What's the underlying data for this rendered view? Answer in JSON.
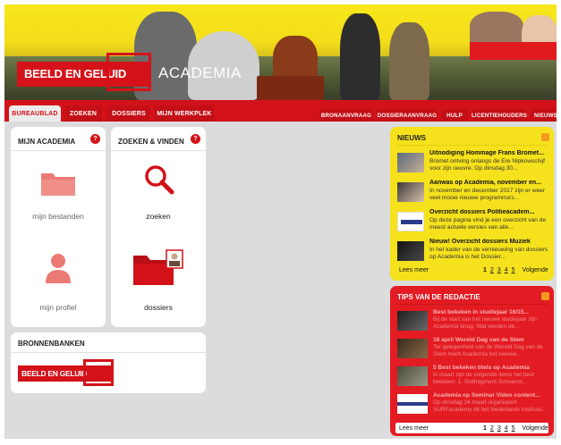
{
  "banner": {
    "logo_text": "BEELD EN GELUID",
    "title": "ACADEMIA"
  },
  "nav": {
    "left_tabs": [
      "BUREAUBLAD",
      "ZOEKEN",
      "DOSSIERS",
      "MIJN WERKPLEK"
    ],
    "right_tabs": [
      "BRONAANVRAAG",
      "DOSSIERAANVRAAG",
      "HULP",
      "LICENTIEHOUDERS",
      "NIEUWS"
    ]
  },
  "mijn_academia": {
    "title": "MIJN ACADEMIA",
    "tiles": [
      {
        "label": "mijn bestanden",
        "icon": "folder-icon"
      },
      {
        "label": "mijn profiel",
        "icon": "user-icon"
      }
    ]
  },
  "zoeken_vinden": {
    "title": "ZOEKEN & VINDEN",
    "tiles": [
      {
        "label": "zoeken",
        "icon": "search-icon"
      },
      {
        "label": "dossiers",
        "icon": "dossier-folder-icon"
      }
    ]
  },
  "bronnenbanken": {
    "title": "BRONNENBANKEN",
    "logo_text": "BEELD EN GELUID"
  },
  "nieuws": {
    "title": "NIEUWS",
    "items": [
      {
        "title": "Uitnodiging Hommage Frans Bromet...",
        "text": "Bromet ontving onlangs de Ere Nipkowschijf voor zijn oeuvre. Op dinsdag 30..."
      },
      {
        "title": "Aanwas op Academia, november en...",
        "text": "In november en december 2017 zijn er weer veel mooie nieuwe programma's..."
      },
      {
        "title": "Overzicht dossiers Politieacadem...",
        "text": "Op deze pagina vind je een overzicht van de meest actuele versies van alle..."
      },
      {
        "title": "Nieuw! Overzicht dossiers Muziek",
        "text": "In het kader van de vernieuwing van dossiers op Academia is het Dossier..."
      }
    ],
    "more": "Lees meer",
    "pages": [
      "1",
      "2",
      "3",
      "4",
      "5"
    ],
    "next": "Volgende"
  },
  "tips": {
    "title": "TIPS VAN DE REDACTIE",
    "items": [
      {
        "title": "Best bekeken in studiejaar 16/15...",
        "text": "Bij de start van het nieuwe studiejaar zijn Academia terug. Wat werden de..."
      },
      {
        "title": "18 april Wereld Dag van de Stem",
        "text": "Ter gelegenheid van de Wereld Dag van de Stem heeft Academia het nieuwe..."
      },
      {
        "title": "5 Best bekeken titels op Academia",
        "text": "In maart zijn de volgende items het best bekeken: 1. Slotfragment Schoenm..."
      },
      {
        "title": "Academia op Seminar Video content...",
        "text": "Op dinsdag 24 maart organiseert SURFacademy dit het Nederlands Instituut..."
      }
    ],
    "more": "Lees meer",
    "pages": [
      "1",
      "2",
      "3",
      "4",
      "5"
    ],
    "next": "Volgende"
  },
  "colors": {
    "brand_red": "#d31119",
    "news_yellow": "#f6e21c",
    "tips_red": "#e31b22",
    "background": "#dcdcdc"
  }
}
